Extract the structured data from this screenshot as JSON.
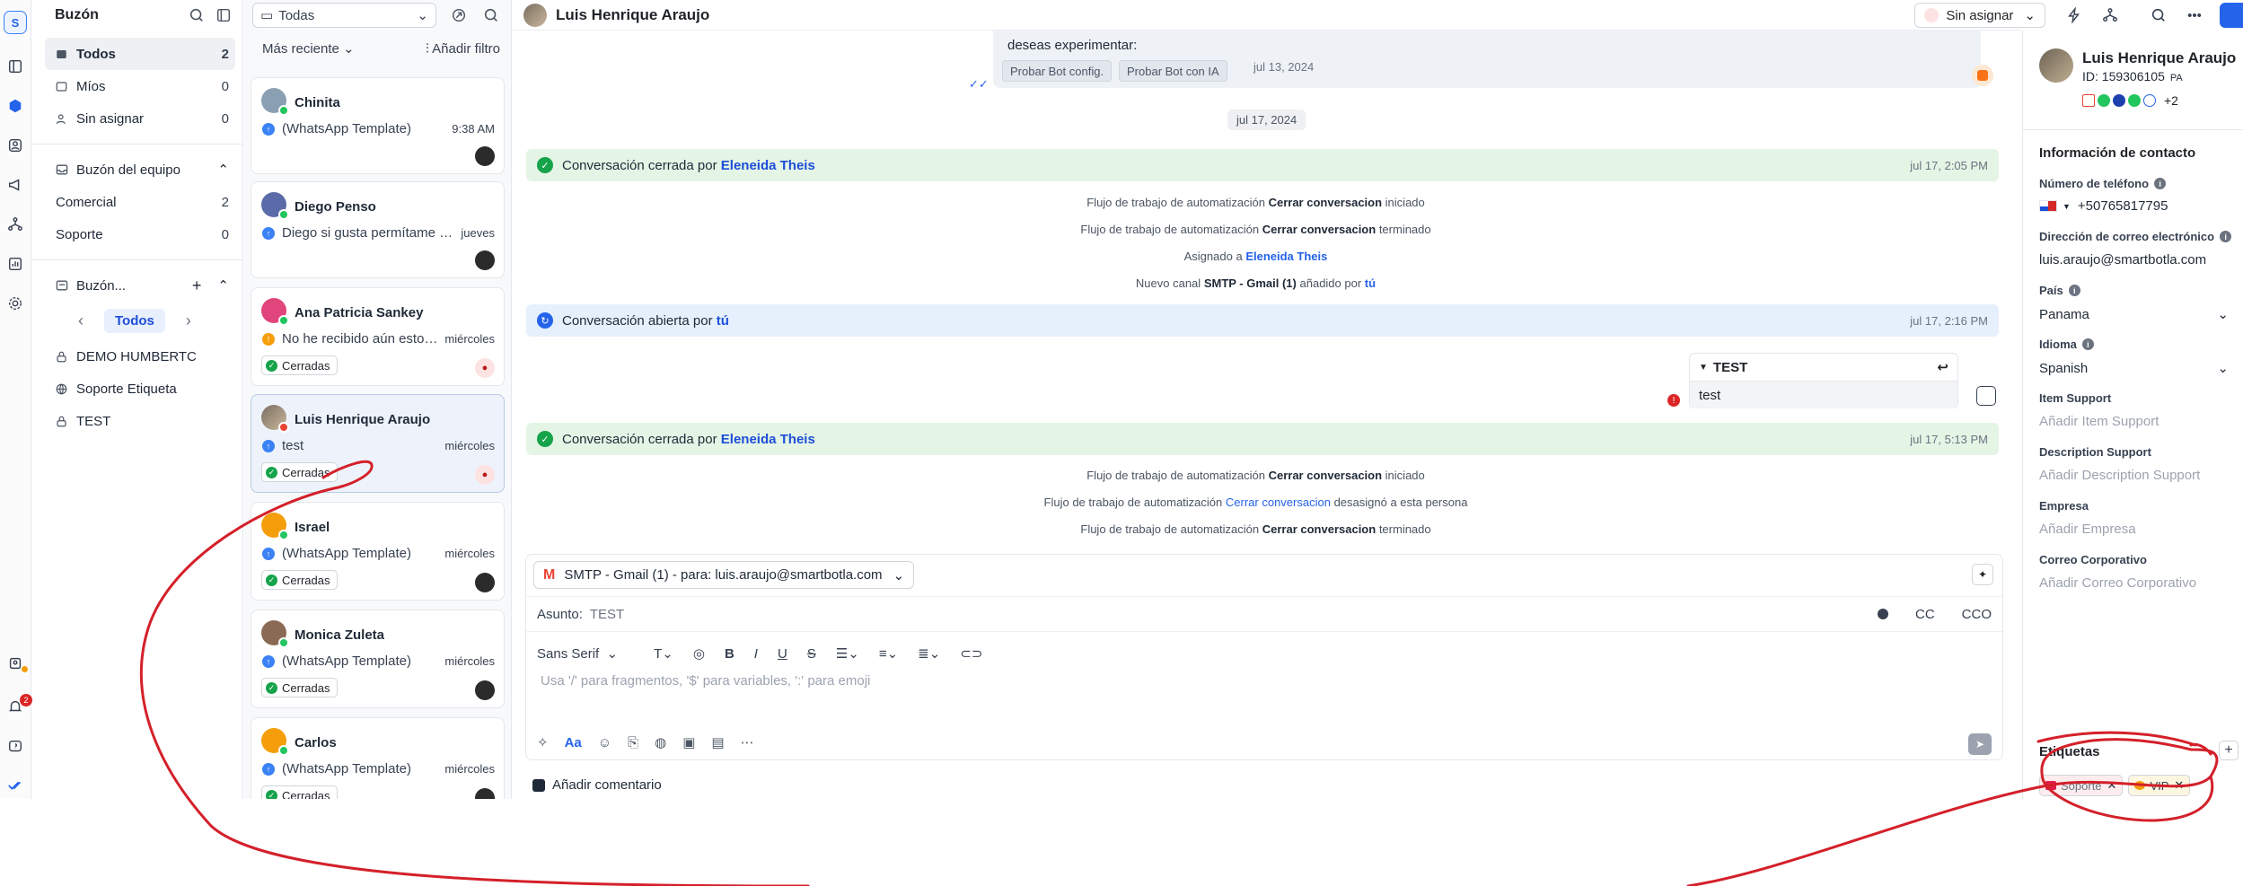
{
  "nav": {
    "title": "Buzón",
    "items": [
      {
        "label": "Todos",
        "count": "2"
      },
      {
        "label": "Míos",
        "count": "0"
      },
      {
        "label": "Sin asignar",
        "count": "0"
      }
    ],
    "team_section": "Buzón del equipo",
    "team_items": [
      {
        "label": "Comercial",
        "count": "2"
      },
      {
        "label": "Soporte",
        "count": "0"
      }
    ],
    "custom_section": "Buzón...",
    "pager_label": "Todos",
    "custom_items": [
      "DEMO HUMBERTC",
      "Soporte Etiqueta",
      "TEST"
    ]
  },
  "rail": {
    "logo": "S",
    "notif_count": "2"
  },
  "list": {
    "filter_select": "Todas",
    "sort": "Más reciente",
    "add_filter": "Añadir filtro",
    "conversations": [
      {
        "name": "Chinita",
        "message": "(WhatsApp Template)",
        "time": "9:38 AM",
        "tag": ""
      },
      {
        "name": "Diego Penso",
        "message": "Diego si gusta permítame su...",
        "time": "jueves",
        "tag": ""
      },
      {
        "name": "Ana Patricia Sankey",
        "message": "No he recibido aún estoy...",
        "time": "miércoles",
        "tag": "Cerradas"
      },
      {
        "name": "Luis Henrique Araujo",
        "message": "test",
        "time": "miércoles",
        "tag": "Cerradas"
      },
      {
        "name": "Israel",
        "message": "(WhatsApp Template)",
        "time": "miércoles",
        "tag": "Cerradas"
      },
      {
        "name": "Monica Zuleta",
        "message": "(WhatsApp Template)",
        "time": "miércoles",
        "tag": "Cerradas"
      },
      {
        "name": "Carlos",
        "message": "(WhatsApp Template)",
        "time": "miércoles",
        "tag": "Cerradas"
      }
    ]
  },
  "header": {
    "contact_name": "Luis Henrique Araujo",
    "assign_label": "Sin asignar"
  },
  "thread": {
    "bot_text": "deseas experimentar:",
    "bot_buttons": [
      "Probar Bot config.",
      "Probar Bot con IA"
    ],
    "bot_date": "jul 13, 2024",
    "date_separator": "jul 17, 2024",
    "closed1": {
      "prefix": "Conversación cerrada por",
      "agent": "Eleneida Theis",
      "time": "jul 17, 2:05 PM"
    },
    "events1": [
      {
        "pre": "Flujo de trabajo de automatización",
        "bold": "Cerrar conversacion",
        "post": "iniciado"
      },
      {
        "pre": "Flujo de trabajo de automatización",
        "bold": "Cerrar conversacion",
        "post": "terminado"
      },
      {
        "pre": "Asignado a",
        "link": "Eleneida Theis"
      },
      {
        "pre": "Nuevo canal",
        "bold": "SMTP - Gmail (1)",
        "post": "añadido por",
        "link": "tú"
      }
    ],
    "opened": {
      "prefix": "Conversación abierta por",
      "agent": "tú",
      "time": "jul 17, 2:16 PM"
    },
    "email": {
      "subject": "TEST",
      "body": "test"
    },
    "closed2": {
      "prefix": "Conversación cerrada por",
      "agent": "Eleneida Theis",
      "time": "jul 17, 5:13 PM"
    },
    "events2": [
      {
        "pre": "Flujo de trabajo de automatización",
        "bold": "Cerrar conversacion",
        "post": "iniciado"
      },
      {
        "pre": "Flujo de trabajo de automatización",
        "link": "Cerrar conversacion",
        "post": "desasignó a esta persona"
      },
      {
        "pre": "Flujo de trabajo de automatización",
        "bold": "Cerrar conversacion",
        "post": "terminado"
      }
    ]
  },
  "composer": {
    "from": "SMTP - Gmail (1) - para: luis.araujo@smartbotla.com",
    "subject_label": "Asunto:",
    "subject_value": "TEST",
    "cc": "CC",
    "cco": "CCO",
    "font": "Sans Serif",
    "placeholder": "Usa '/' para fragmentos, '$' para variables, ':' para emoji",
    "format_label": "Aa",
    "add_comment": "Añadir comentario"
  },
  "contact": {
    "name": "Luis Henrique Araujo",
    "id": "ID: 159306105",
    "country_code": "PA",
    "channels_more": "+2",
    "section_title": "Información de contacto",
    "phone_label": "Número de teléfono",
    "phone": "+50765817795",
    "email_label": "Dirección de correo electrónico",
    "email": "luis.araujo@smartbotla.com",
    "country_label": "País",
    "country": "Panama",
    "language_label": "Idioma",
    "language": "Spanish",
    "item_support_label": "Item Support",
    "item_support_ph": "Añadir Item Support",
    "desc_support_label": "Description Support",
    "desc_support_ph": "Añadir Description Support",
    "company_label": "Empresa",
    "company_ph": "Añadir Empresa",
    "corp_mail_label": "Correo Corporativo",
    "corp_mail_ph": "Añadir Correo Corporativo",
    "tags_title": "Etiquetas",
    "tags": [
      "Soporte",
      "VIP"
    ]
  },
  "colors": {
    "accent": "#2563eb",
    "annotation": "#d4202a",
    "closed_banner": "#e4f5e6",
    "open_banner": "#e6f0fc"
  }
}
